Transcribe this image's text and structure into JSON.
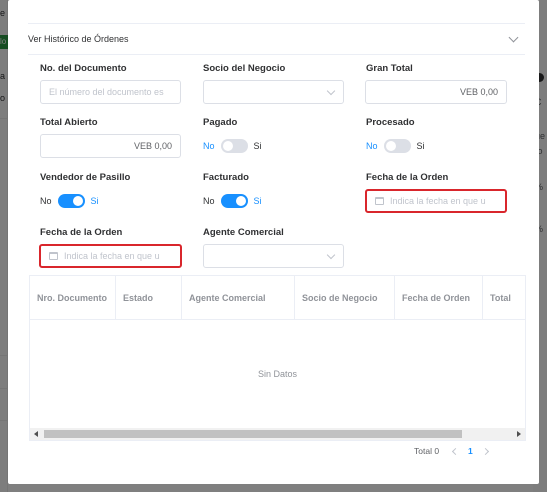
{
  "background": {
    "left_fragments": [
      "e",
      "lo",
      "a",
      "o"
    ],
    "right_fragments": [
      "C",
      "ue",
      "to",
      "%",
      "%"
    ]
  },
  "dialog": {
    "collapse_title": "Ver Histórico de Órdenes",
    "fields": {
      "document_no": {
        "label": "No. del Documento",
        "placeholder": "El número del documento es"
      },
      "business_partner": {
        "label": "Socio del Negocio",
        "value": ""
      },
      "grand_total": {
        "label": "Gran Total",
        "value": "VEB 0,00"
      },
      "open_total": {
        "label": "Total Abierto",
        "value": "VEB 0,00"
      },
      "paid": {
        "label": "Pagado",
        "off": "No",
        "on": "Si",
        "state": false
      },
      "processed": {
        "label": "Procesado",
        "off": "No",
        "on": "Si",
        "state": false
      },
      "aisle_seller": {
        "label": "Vendedor de Pasillo",
        "off": "No",
        "on": "Si",
        "state": true
      },
      "invoiced": {
        "label": "Facturado",
        "off": "No",
        "on": "Si",
        "state": true
      },
      "order_date_from": {
        "label": "Fecha de la Orden",
        "placeholder": "Indica la fecha en que u"
      },
      "order_date_to": {
        "label": "Fecha de la Orden",
        "placeholder": "Indica la fecha en que u"
      },
      "sales_agent": {
        "label": "Agente Comercial",
        "value": ""
      }
    },
    "table": {
      "columns": [
        "Nro. Documento",
        "Estado",
        "Agente Comercial",
        "Socio de Negocio",
        "Fecha de Orden",
        "Total"
      ],
      "empty_text": "Sin Datos"
    },
    "pagination": {
      "total_label": "Total 0",
      "current_page": "1"
    }
  },
  "colors": {
    "accent": "#1890ff",
    "error_border": "#d9262c",
    "overlay": "rgba(0,0,0,0.5)"
  },
  "icons": [
    "chevron-down-icon",
    "calendar-icon",
    "select-arrow-icon",
    "prev-page-icon",
    "next-page-icon"
  ]
}
